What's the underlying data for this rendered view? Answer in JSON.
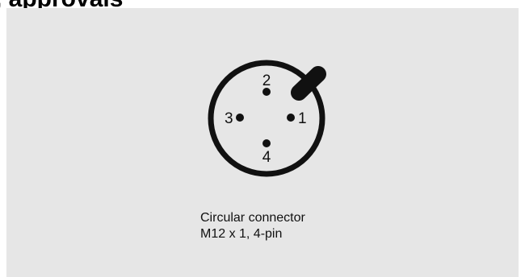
{
  "header": {
    "title_fragment": ", approvals"
  },
  "connector": {
    "pins": [
      {
        "number": "1"
      },
      {
        "number": "2"
      },
      {
        "number": "3"
      },
      {
        "number": "4"
      }
    ]
  },
  "caption": {
    "line1": "Circular connector",
    "line2": "M12 x 1, 4-pin"
  },
  "colors": {
    "panel_background": "#e6e6e6",
    "ink": "#111111"
  }
}
